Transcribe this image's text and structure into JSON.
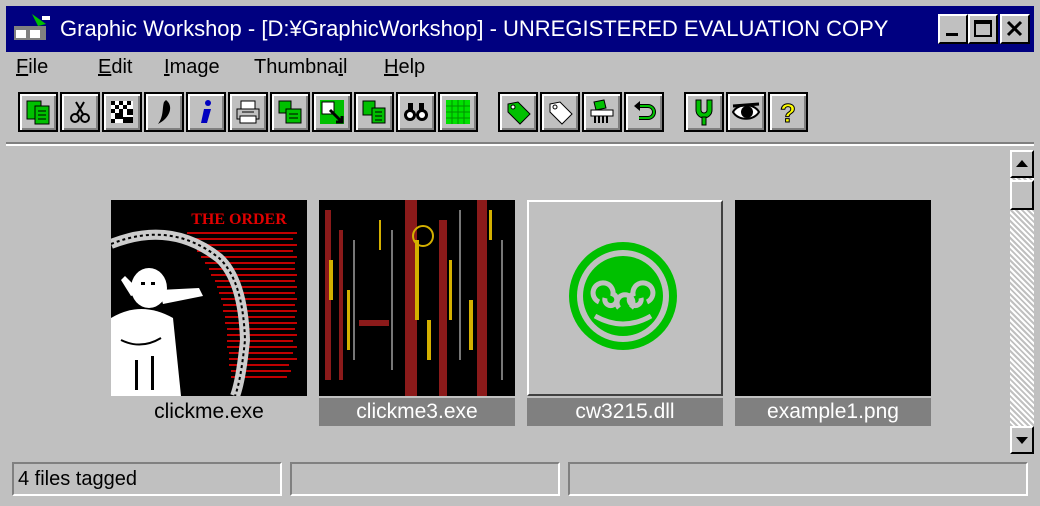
{
  "window": {
    "title": "Graphic Workshop - [D:¥GraphicWorkshop] - UNREGISTERED EVALUATION COPY",
    "controls": [
      "minimize",
      "maximize",
      "close"
    ]
  },
  "menu": {
    "file": "File",
    "edit": "Edit",
    "image": "Image",
    "thumbnail": "Thumbnail",
    "help": "Help"
  },
  "toolbar": [
    {
      "name": "copy-tool-icon"
    },
    {
      "name": "scissors-icon"
    },
    {
      "name": "dither-icon"
    },
    {
      "name": "chili-icon"
    },
    {
      "name": "info-icon"
    },
    {
      "name": "printer-icon"
    },
    {
      "name": "paste-icon"
    },
    {
      "name": "crop-icon"
    },
    {
      "name": "convert-icon"
    },
    {
      "name": "binoculars-icon"
    },
    {
      "name": "grid-icon"
    },
    {
      "name": "tag-icon"
    },
    {
      "name": "untag-icon"
    },
    {
      "name": "shredder-icon"
    },
    {
      "name": "undo-icon"
    },
    {
      "name": "tuning-fork-icon"
    },
    {
      "name": "eye-icon"
    },
    {
      "name": "help-icon"
    }
  ],
  "thumbnails": [
    {
      "label": "clickme.exe",
      "tagged": false
    },
    {
      "label": "clickme3.exe",
      "tagged": true
    },
    {
      "label": "cw3215.dll",
      "tagged": true
    },
    {
      "label": "example1.png",
      "tagged": true
    }
  ],
  "thumbnail_art": {
    "heading": "THE ORDER"
  },
  "status": {
    "pane1": "4 files tagged",
    "pane2": "",
    "pane3": ""
  },
  "colors": {
    "titlebar": "#000080",
    "face": "#c0c0c0",
    "accent_green": "#00c000",
    "tag_highlight": "#808080"
  }
}
